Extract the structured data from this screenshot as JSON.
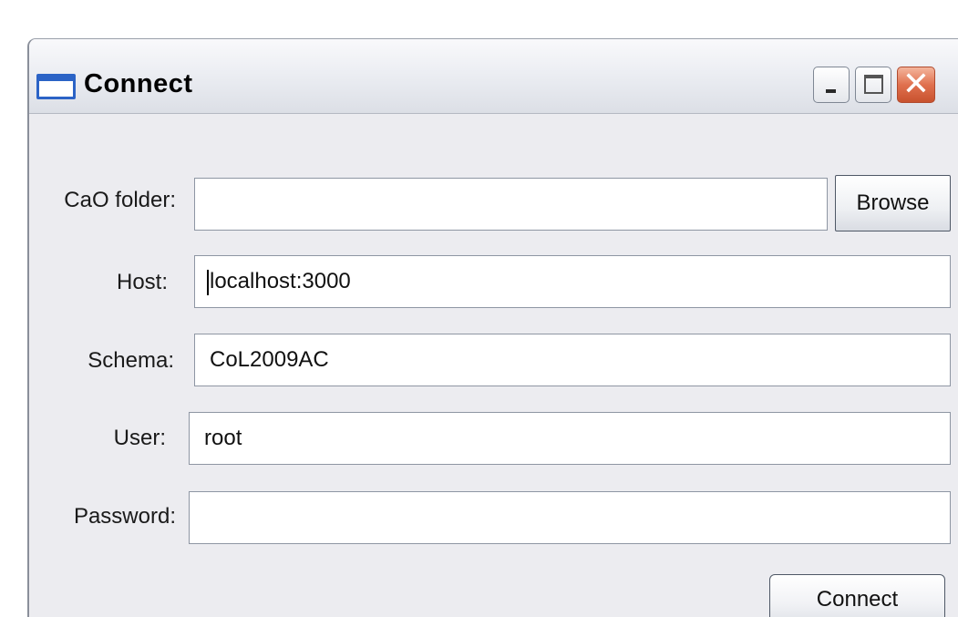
{
  "window": {
    "title": "Connect",
    "close_glyph": "✕"
  },
  "form": {
    "cao_folder": {
      "label": "CaO folder:",
      "value": ""
    },
    "browse_label": "Browse",
    "host": {
      "label": "Host:",
      "value": "localhost:3000"
    },
    "schema": {
      "label": "Schema:",
      "value": "CoL2009AC"
    },
    "user": {
      "label": "User:",
      "value": "root"
    },
    "password": {
      "label": "Password:",
      "value": ""
    },
    "connect_label": "Connect"
  },
  "colors": {
    "accent": "#2b63c6",
    "close_button": "#d9623f",
    "dialog_background": "#ececf0"
  },
  "icons": {
    "window_icon": "window-icon",
    "minimize": "minimize-icon",
    "maximize": "maximize-icon",
    "close": "close-icon"
  }
}
